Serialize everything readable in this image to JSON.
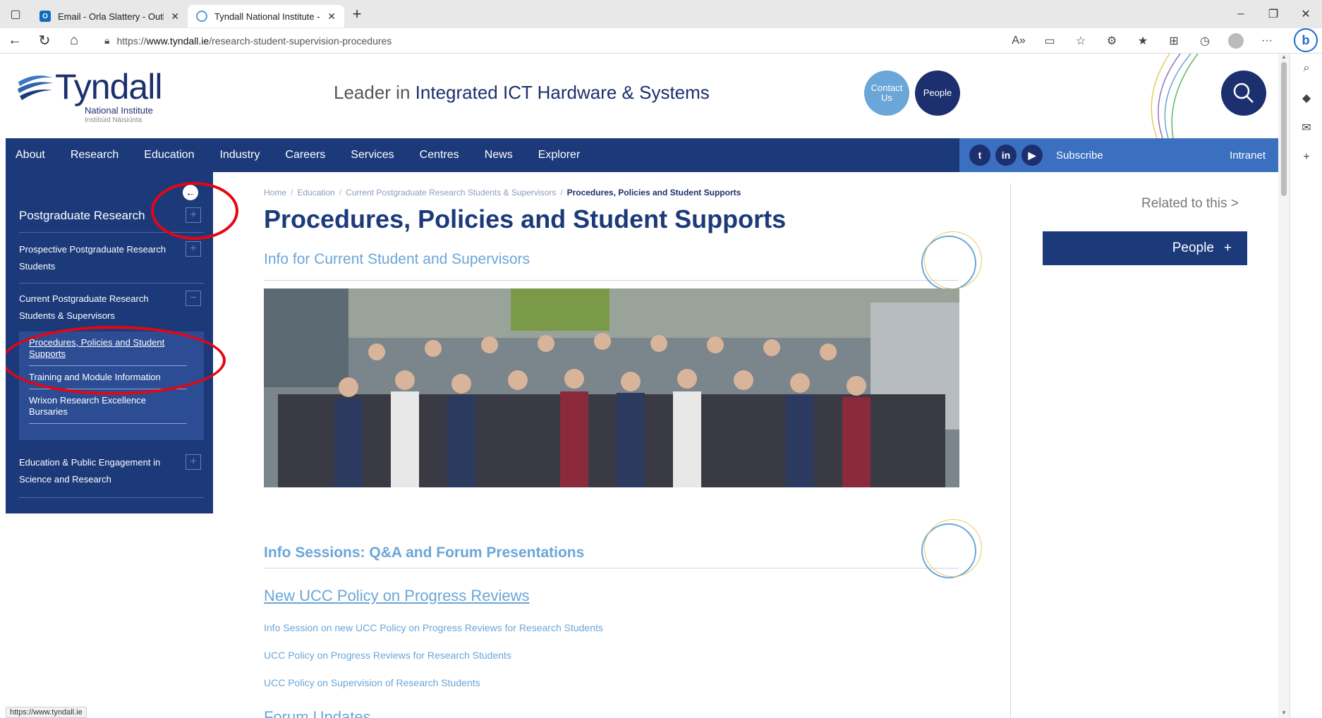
{
  "browser": {
    "tabs": [
      {
        "title": "Email - Orla Slattery - Outlook",
        "active": false
      },
      {
        "title": "Tyndall National Institute - Proce",
        "active": true
      }
    ],
    "url_prefix": "https://",
    "url_host": "www.tyndall.ie",
    "url_path": "/research-student-supervision-procedures",
    "status_url": "https://www.tyndall.ie"
  },
  "header": {
    "logo_word": "Tyndall",
    "logo_sub": "National Institute",
    "logo_sub2": "Institiúid Náisiúnta",
    "tagline_prefix": "Leader in ",
    "tagline_main": "Integrated ICT Hardware & Systems",
    "contact_label": "Contact Us",
    "people_label": "People"
  },
  "mainnav": {
    "items": [
      "About",
      "Research",
      "Education",
      "Industry",
      "Careers",
      "Services",
      "Centres",
      "News",
      "Explorer"
    ],
    "social": [
      "twitter-icon",
      "linkedin-icon",
      "youtube-icon"
    ],
    "social_glyphs": {
      "twitter": "t",
      "linkedin": "in",
      "youtube": "▶"
    },
    "subscribe": "Subscribe",
    "intranet": "Intranet"
  },
  "sidenav": {
    "title": "Postgraduate Research",
    "items": [
      "Prospective Postgraduate Research Students",
      "Current Postgraduate Research Students & Supervisors",
      "Education & Public Engagement in Science and Research"
    ],
    "subitems": [
      "Procedures, Policies and Student Supports",
      "Training and Module Information",
      "Wrixon Research Excellence Bursaries"
    ]
  },
  "breadcrumb": [
    "Home",
    "Education",
    "Current Postgraduate Research Students & Supervisors",
    "Procedures, Policies and Student Supports"
  ],
  "main": {
    "title": "Procedures, Policies and Student Supports",
    "section1": "Info for Current Student and Supervisors",
    "section2": "Info Sessions:  Q&A and Forum Presentations",
    "policy_link": "New UCC Policy on Progress Reviews",
    "doc_links": [
      "Info Session on new UCC Policy on Progress Reviews for Research Students",
      "UCC Policy on Progress Reviews for Research Students",
      "UCC Policy on Supervision of Research Students"
    ],
    "partial_heading": "Forum Updates"
  },
  "related": {
    "title": "Related to this >",
    "people": "People"
  },
  "colors": {
    "navy": "#1c3a7a",
    "light_blue": "#6aa6d8",
    "annotation_red": "#e30613"
  }
}
